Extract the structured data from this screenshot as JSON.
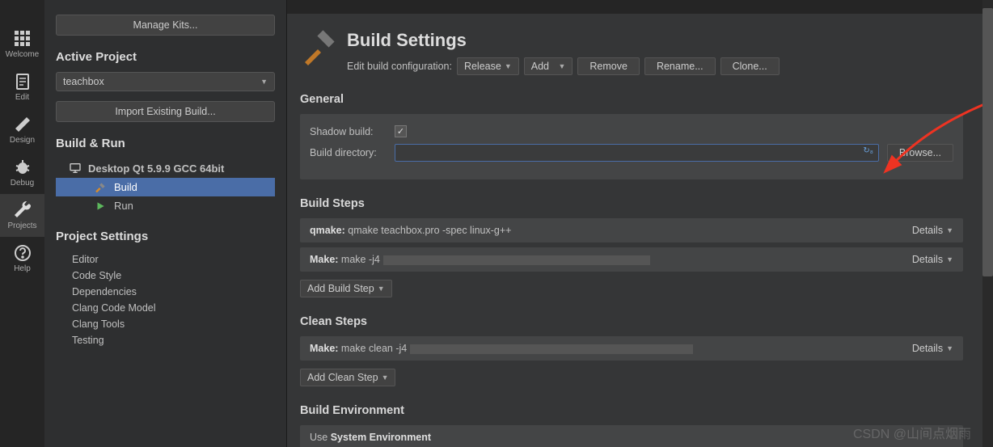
{
  "sidebar": {
    "items": [
      {
        "label": "Welcome",
        "icon": "grid"
      },
      {
        "label": "Edit",
        "icon": "doc"
      },
      {
        "label": "Design",
        "icon": "pencil"
      },
      {
        "label": "Debug",
        "icon": "bug"
      },
      {
        "label": "Projects",
        "icon": "wrench",
        "active": true
      },
      {
        "label": "Help",
        "icon": "help"
      }
    ]
  },
  "project_panel": {
    "manage_kits": "Manage Kits...",
    "active_project_heading": "Active Project",
    "active_project_value": "teachbox",
    "import_build": "Import Existing Build...",
    "build_run_heading": "Build & Run",
    "kit_label": "Desktop Qt 5.9.9 GCC 64bit",
    "build_label": "Build",
    "run_label": "Run",
    "project_settings_heading": "Project Settings",
    "settings_items": [
      "Editor",
      "Code Style",
      "Dependencies",
      "Clang Code Model",
      "Clang Tools",
      "Testing"
    ]
  },
  "main": {
    "title": "Build Settings",
    "edit_config_label": "Edit build configuration:",
    "config_value": "Release",
    "add_btn": "Add",
    "remove_btn": "Remove",
    "rename_btn": "Rename...",
    "clone_btn": "Clone...",
    "general_heading": "General",
    "shadow_build_label": "Shadow build:",
    "shadow_build_checked": "✓",
    "build_dir_label": "Build directory:",
    "build_dir_value": "",
    "build_dir_badge": "↻₈",
    "browse_btn": "Browse...",
    "build_steps_heading": "Build Steps",
    "qmake_label": "qmake:",
    "qmake_cmd": "qmake teachbox.pro -spec linux-g++",
    "make_label": "Make:",
    "make_cmd": "make -j4",
    "details_label": "Details",
    "add_build_step": "Add Build Step",
    "clean_steps_heading": "Clean Steps",
    "clean_make_label": "Make:",
    "clean_make_cmd": "make clean -j4",
    "add_clean_step": "Add Clean Step",
    "build_env_heading": "Build Environment",
    "use_label": "Use",
    "env_value": "System Environment"
  },
  "watermark": "CSDN @山间点烟雨"
}
